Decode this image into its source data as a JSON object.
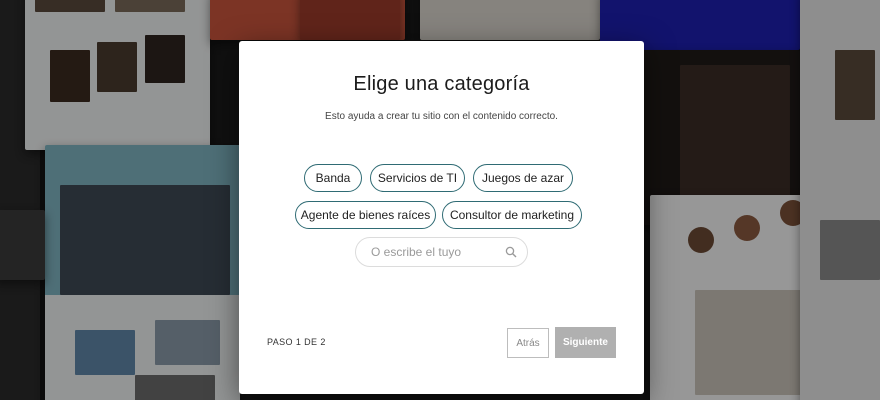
{
  "modal": {
    "title": "Elige una categoría",
    "subtitle": "Esto ayuda a crear tu sitio con el contenido correcto.",
    "chips": [
      "Banda",
      "Servicios de TI",
      "Juegos de azar",
      "Agente de bienes raíces",
      "Consultor de marketing"
    ],
    "search": {
      "placeholder": "O escribe el tuyo",
      "value": "",
      "icon": "search-icon"
    },
    "step_label": "PASO 1 DE 2",
    "back_label": "Atrás",
    "next_label": "Siguiente"
  },
  "colors": {
    "chip_border": "#2f6b74",
    "next_button_bg": "#b0b0b0",
    "modal_bg": "#ffffff",
    "background_overlay": "#1b1b1b"
  }
}
